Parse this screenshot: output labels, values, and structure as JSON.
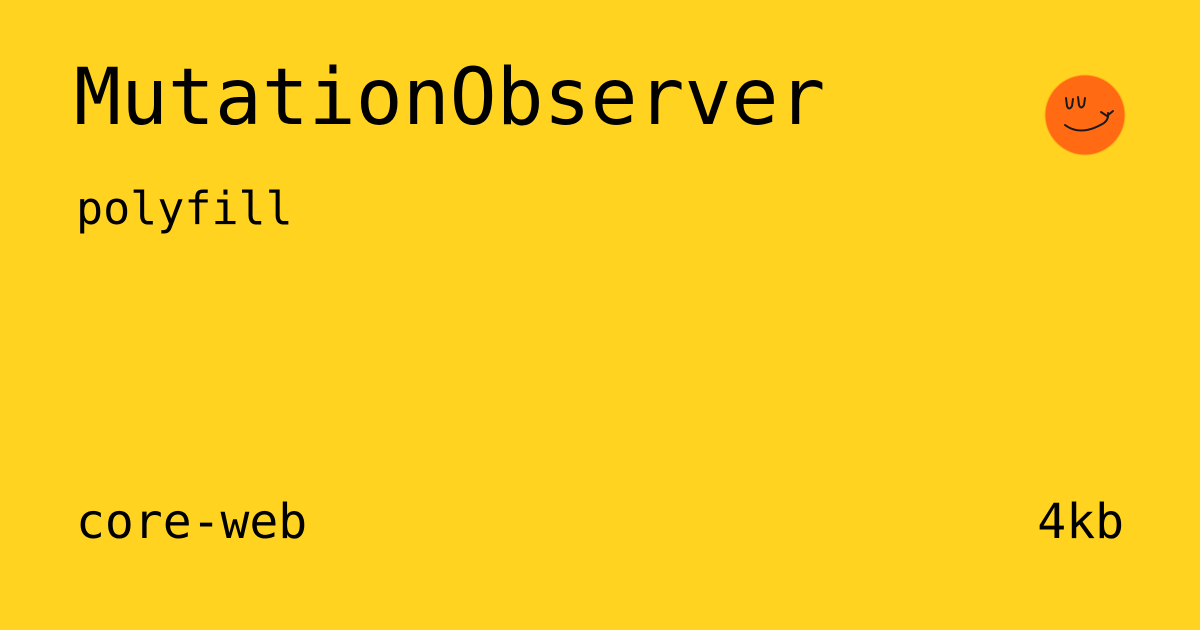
{
  "package": {
    "name": "MutationObserver",
    "type": "polyfill",
    "group": "core-web",
    "size": "4kb"
  },
  "logo": {
    "icon": "smiley-face-logo-icon",
    "background_color": "#ff6a13",
    "stroke_color": "#1a1a1a"
  },
  "colors": {
    "background": "#ffd31f",
    "text": "#000000"
  }
}
